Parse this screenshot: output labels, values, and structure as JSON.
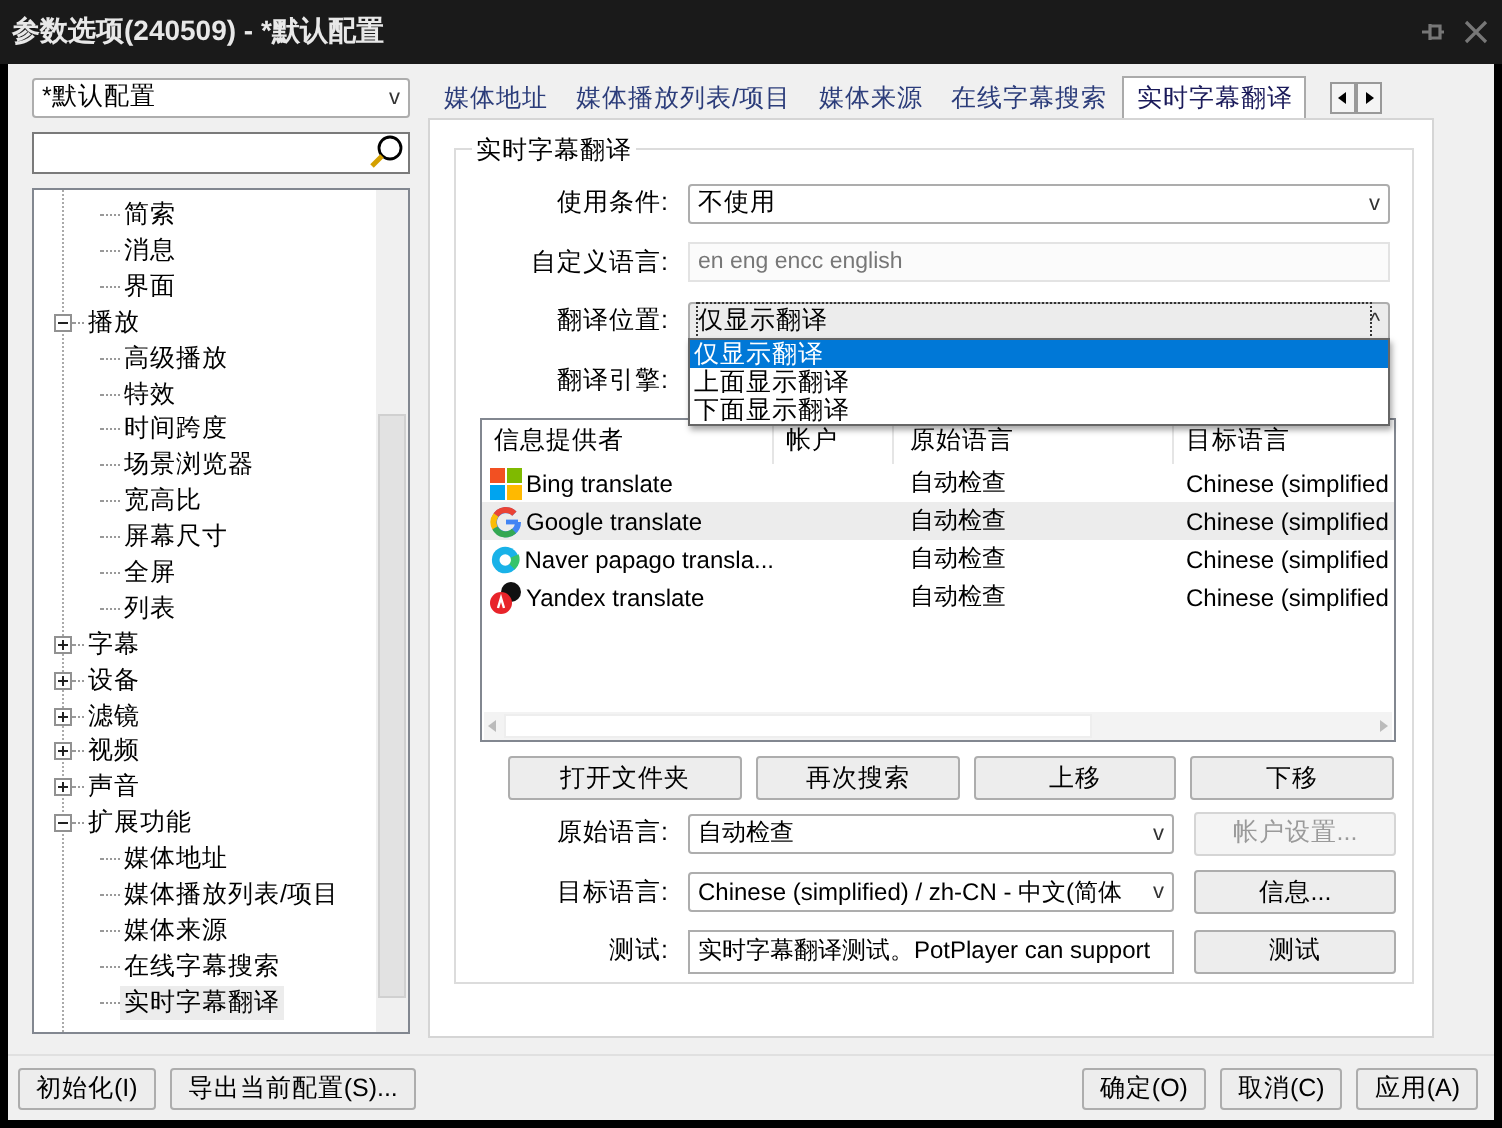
{
  "window": {
    "title": "参数选项(240509) - *默认配置"
  },
  "profile_combo": {
    "value": "*默认配置",
    "arrow": "v"
  },
  "tree": [
    {
      "children": [
        {
          "label": "简索",
          "selected": false
        },
        {
          "label": "消息",
          "selected": false
        },
        {
          "label": "界面",
          "selected": false
        }
      ]
    },
    {
      "label": "播放",
      "expanded": true,
      "children": [
        {
          "label": "高级播放",
          "selected": false
        },
        {
          "label": "特效",
          "selected": false
        },
        {
          "label": "时间跨度",
          "selected": false
        },
        {
          "label": "场景浏览器",
          "selected": false
        },
        {
          "label": "宽高比",
          "selected": false
        },
        {
          "label": "屏幕尺寸",
          "selected": false
        },
        {
          "label": "全屏",
          "selected": false
        },
        {
          "label": "列表",
          "selected": false
        }
      ]
    },
    {
      "label": "字幕",
      "expanded": false
    },
    {
      "label": "设备",
      "expanded": false
    },
    {
      "label": "滤镜",
      "expanded": false
    },
    {
      "label": "视频",
      "expanded": false
    },
    {
      "label": "声音",
      "expanded": false
    },
    {
      "label": "扩展功能",
      "expanded": true,
      "children": [
        {
          "label": "媒体地址",
          "selected": false
        },
        {
          "label": "媒体播放列表/项目",
          "selected": false
        },
        {
          "label": "媒体来源",
          "selected": false
        },
        {
          "label": "在线字幕搜索",
          "selected": false
        },
        {
          "label": "实时字幕翻译",
          "selected": true
        }
      ]
    }
  ],
  "tabs": [
    {
      "label": "媒体地址",
      "selected": false
    },
    {
      "label": "媒体播放列表/项目",
      "selected": false
    },
    {
      "label": "媒体来源",
      "selected": false
    },
    {
      "label": "在线字幕搜索",
      "selected": false
    },
    {
      "label": "实时字幕翻译",
      "selected": true
    }
  ],
  "group": {
    "title": "实时字幕翻译",
    "condition": {
      "label": "使用条件:",
      "value": "不使用",
      "arrow": "v"
    },
    "custom_language": {
      "label": "自定义语言:",
      "placeholder": "en eng encc english"
    },
    "position": {
      "label": "翻译位置:",
      "value": "仅显示翻译",
      "arrow": "^",
      "options": [
        {
          "label": "仅显示翻译",
          "selected": true
        },
        {
          "label": "上面显示翻译",
          "selected": false
        },
        {
          "label": "下面显示翻译",
          "selected": false
        }
      ]
    },
    "engine": {
      "label": "翻译引擎:"
    },
    "table": {
      "columns": [
        "信息提供者",
        "帐户",
        "原始语言",
        "目标语言"
      ],
      "rows": [
        {
          "kind": "bing",
          "provider": "Bing translate",
          "source": "自动检查",
          "target": "Chinese (simplified",
          "selected": false
        },
        {
          "kind": "google",
          "provider": "Google translate",
          "source": "自动检查",
          "target": "Chinese (simplified",
          "selected": true
        },
        {
          "kind": "naver",
          "provider": "Naver papago transla...",
          "source": "自动检查",
          "target": "Chinese (simplified",
          "selected": false
        },
        {
          "kind": "yandex",
          "provider": "Yandex translate",
          "source": "自动检查",
          "target": "Chinese (simplified",
          "selected": false
        }
      ]
    },
    "buttons": [
      "打开文件夹",
      "再次搜索",
      "上移",
      "下移"
    ],
    "source_language": {
      "label": "原始语言:",
      "value": "自动检查",
      "arrow": "v",
      "button": "帐户设置...",
      "button_disabled": true
    },
    "target_language": {
      "label": "目标语言:",
      "value": "Chinese (simplified) / zh-CN - 中文(简体",
      "arrow": "v",
      "button": "信息..."
    },
    "test": {
      "label": "测试:",
      "value": "实时字幕翻译测试。PotPlayer can support",
      "button": "测试"
    }
  },
  "footer": {
    "left_buttons": [
      "初始化(I)",
      "导出当前配置(S)..."
    ],
    "right_buttons": [
      "确定(O)",
      "取消(C)",
      "应用(A)"
    ]
  }
}
